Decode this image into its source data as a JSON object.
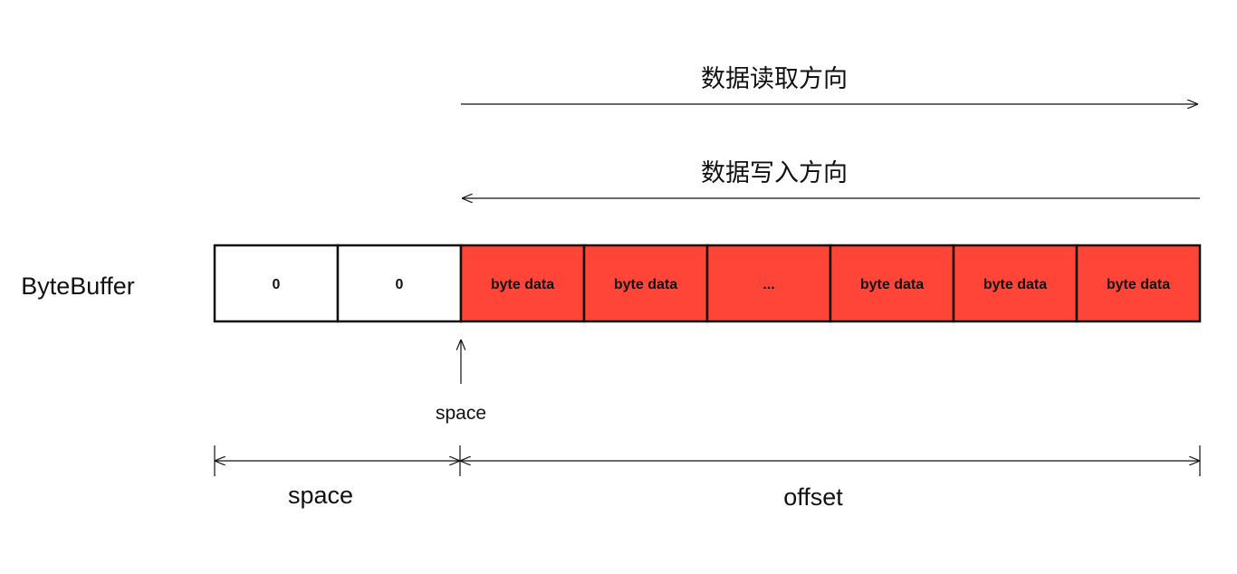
{
  "labels": {
    "read_direction": "数据读取方向",
    "write_direction": "数据写入方向",
    "buffer_name": "ByteBuffer",
    "space_pointer": "space",
    "space_span": "space",
    "offset_span": "offset"
  },
  "cells": [
    {
      "text": "0",
      "filled": false
    },
    {
      "text": "0",
      "filled": false
    },
    {
      "text": "byte data",
      "filled": true
    },
    {
      "text": "byte data",
      "filled": true
    },
    {
      "text": "...",
      "filled": true
    },
    {
      "text": "byte data",
      "filled": true
    },
    {
      "text": "byte data",
      "filled": true
    },
    {
      "text": "byte data",
      "filled": true
    }
  ],
  "colors": {
    "filled": "#ff4538",
    "empty": "#ffffff",
    "stroke": "#111111"
  }
}
